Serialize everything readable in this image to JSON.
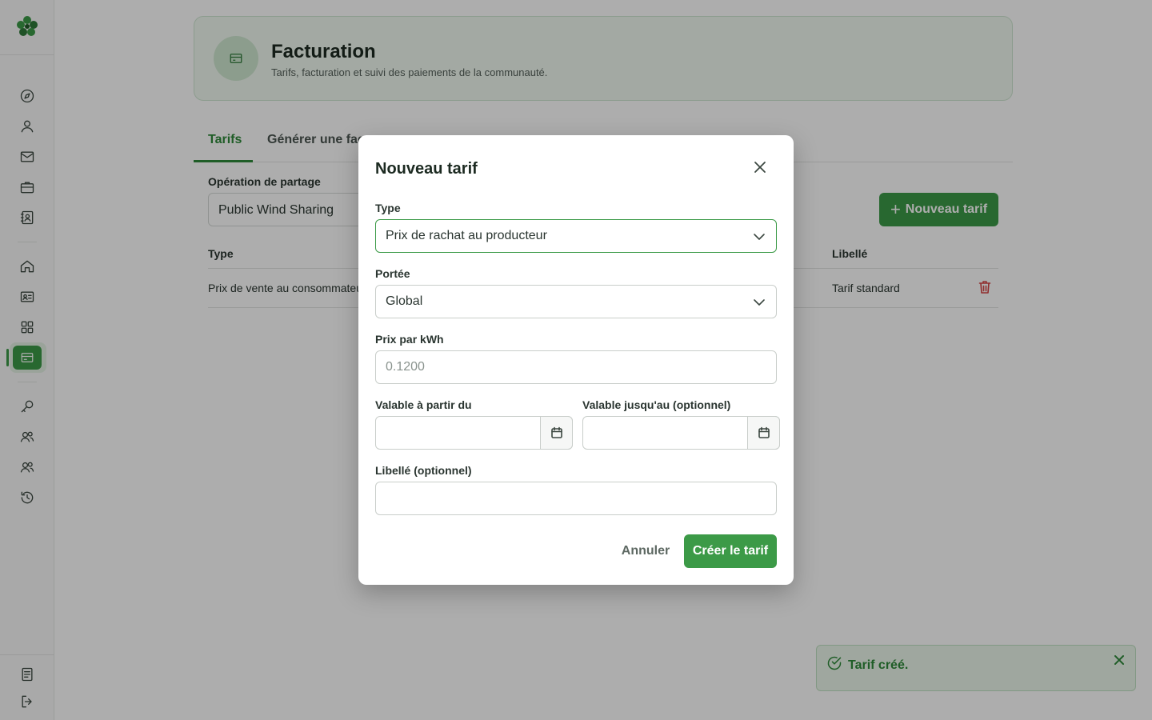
{
  "header": {
    "title": "Facturation",
    "subtitle": "Tarifs, facturation et suivi des paiements de la communauté."
  },
  "tabs": [
    {
      "label": "Tarifs",
      "active": true
    },
    {
      "label": "Générer une fac",
      "active": false
    }
  ],
  "filters": {
    "operation_label": "Opération de partage",
    "operation_value": "Public Wind Sharing"
  },
  "actions": {
    "new_tariff_label": "Nouveau tarif"
  },
  "table": {
    "columns": {
      "type": "Type",
      "label": "Libellé"
    },
    "rows": [
      {
        "type": "Prix de vente au consommateu",
        "label": "Tarif standard"
      }
    ]
  },
  "modal": {
    "title": "Nouveau tarif",
    "type_label": "Type",
    "type_value": "Prix de rachat au producteur",
    "scope_label": "Portée",
    "scope_value": "Global",
    "price_label": "Prix par kWh",
    "price_placeholder": "0.1200",
    "valid_from_label": "Valable à partir du",
    "valid_from_value": "",
    "valid_until_label": "Valable jusqu'au (optionnel)",
    "valid_until_value": "",
    "name_label": "Libellé (optionnel)",
    "name_value": "",
    "cancel_label": "Annuler",
    "submit_label": "Créer le tarif"
  },
  "toast": {
    "message": "Tarif créé."
  },
  "sidebar": {
    "icons": [
      "compass-icon",
      "user-icon",
      "mail-icon",
      "briefcase-icon",
      "contact-card-icon",
      "home-icon",
      "id-card-icon",
      "grid-icon",
      "billing-icon",
      "key-icon",
      "users-icon",
      "group-icon",
      "history-icon",
      "document-icon",
      "logout-icon"
    ],
    "active": "billing-icon"
  },
  "colors": {
    "accent": "#3c9a47",
    "danger": "#d64545",
    "toast_bg": "#eaf6ea"
  }
}
